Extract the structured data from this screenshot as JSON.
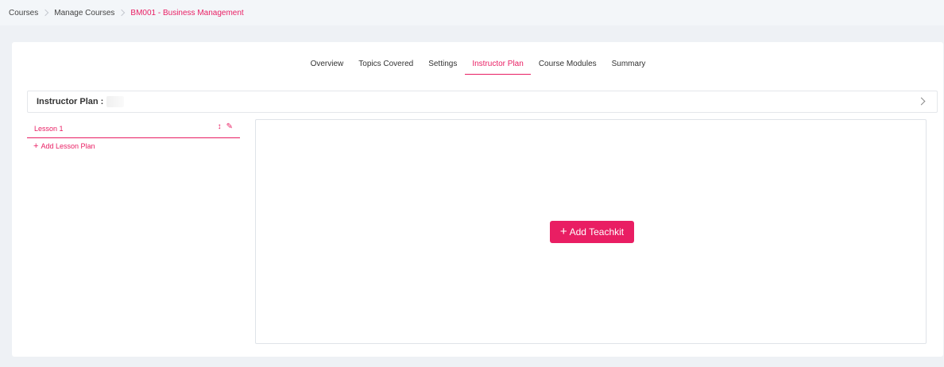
{
  "breadcrumb": {
    "items": [
      "Courses",
      "Manage Courses",
      "BM001 - Business Management"
    ]
  },
  "tabs": [
    {
      "label": "Overview"
    },
    {
      "label": "Topics Covered"
    },
    {
      "label": "Settings"
    },
    {
      "label": "Instructor Plan",
      "active": true
    },
    {
      "label": "Course Modules"
    },
    {
      "label": "Summary"
    }
  ],
  "plan": {
    "title": "Instructor Plan :"
  },
  "lessons": [
    {
      "name": "Lesson 1"
    }
  ],
  "add_lesson_label": "Add Lesson Plan",
  "add_teachkit_label": "Add Teachkit",
  "icons": {
    "breadcrumb_separator": "chevron-right-icon",
    "plan_expand": "chevron-right-icon",
    "lesson_reorder": "sort-arrows-icon",
    "lesson_edit": "pencil-icon",
    "add": "plus-icon"
  },
  "colors": {
    "accent": "#e91e63",
    "background": "#eef1f5"
  }
}
